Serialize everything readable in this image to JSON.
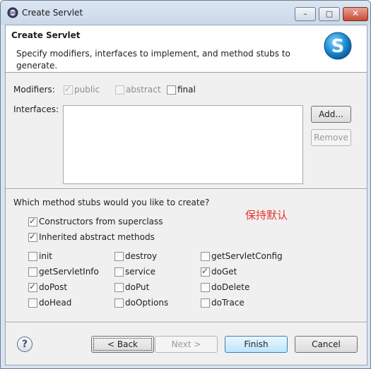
{
  "window": {
    "title": "Create Servlet"
  },
  "header": {
    "title": "Create Servlet",
    "description": "Specify modifiers, interfaces to implement, and method stubs to generate."
  },
  "modifiers": {
    "label": "Modifiers:",
    "public": {
      "label": "public",
      "checked": true,
      "enabled": false
    },
    "abstract": {
      "label": "abstract",
      "checked": false,
      "enabled": false
    },
    "final": {
      "label": "final",
      "checked": false,
      "enabled": true
    }
  },
  "interfaces": {
    "label": "Interfaces:",
    "items": [],
    "add_label": "Add...",
    "remove_label": "Remove"
  },
  "stubs": {
    "question": "Which method stubs would you like to create?",
    "constructors": {
      "label": "Constructors from superclass",
      "checked": true
    },
    "inherited": {
      "label": "Inherited abstract methods",
      "checked": true
    },
    "methods": [
      {
        "label": "init",
        "checked": false
      },
      {
        "label": "destroy",
        "checked": false
      },
      {
        "label": "getServletConfig",
        "checked": false
      },
      {
        "label": "getServletInfo",
        "checked": false
      },
      {
        "label": "service",
        "checked": false
      },
      {
        "label": "doGet",
        "checked": true
      },
      {
        "label": "doPost",
        "checked": true
      },
      {
        "label": "doPut",
        "checked": false
      },
      {
        "label": "doDelete",
        "checked": false
      },
      {
        "label": "doHead",
        "checked": false
      },
      {
        "label": "doOptions",
        "checked": false
      },
      {
        "label": "doTrace",
        "checked": false
      }
    ]
  },
  "annotation": "保持默认",
  "footer": {
    "help_glyph": "?",
    "back_label": "< Back",
    "next_label": "Next >",
    "finish_label": "Finish",
    "cancel_label": "Cancel"
  },
  "titlebar_glyphs": {
    "minimize": "–",
    "maximize": "□",
    "close": "✕"
  },
  "colors": {
    "annotation": "#e5332a",
    "title_bar": "#dbe6f3",
    "logo": "#1e8fd6"
  }
}
